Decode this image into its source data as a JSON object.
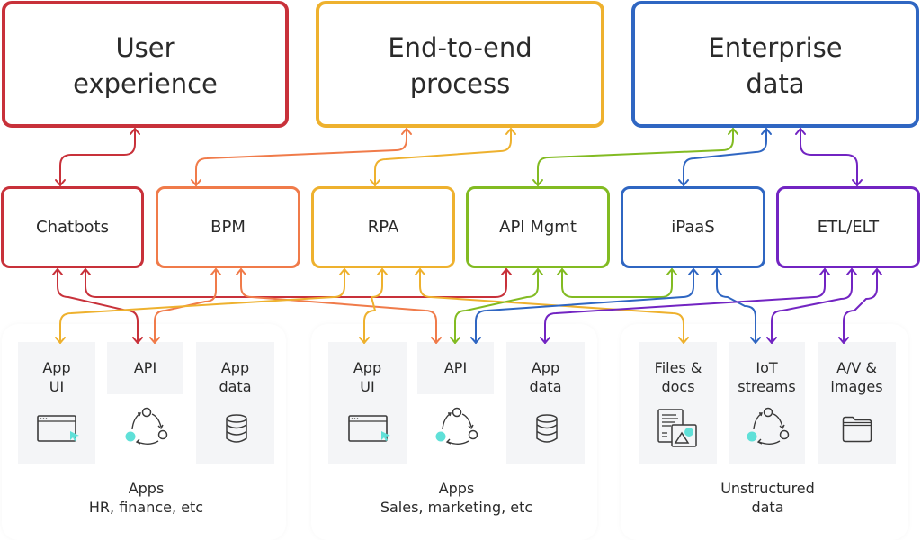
{
  "colors": {
    "red": "#c8313a",
    "orange": "#f07b4a",
    "yellow": "#eeb12e",
    "green": "#82bb22",
    "blue": "#2f66c2",
    "purple": "#7224c2",
    "tile_bg": "#f4f5f7",
    "teal_accent": "#5fe0d8"
  },
  "goals": [
    {
      "id": "ux",
      "label": "User\nexperience",
      "color": "red"
    },
    {
      "id": "e2e",
      "label": "End-to-end\nprocess",
      "color": "yellow"
    },
    {
      "id": "enterprise",
      "label": "Enterprise\ndata",
      "color": "blue"
    }
  ],
  "tools": [
    {
      "id": "chatbots",
      "label": "Chatbots",
      "color": "red"
    },
    {
      "id": "bpm",
      "label": "BPM",
      "color": "orange"
    },
    {
      "id": "rpa",
      "label": "RPA",
      "color": "yellow"
    },
    {
      "id": "apimgmt",
      "label": "API Mgmt",
      "color": "green"
    },
    {
      "id": "ipaas",
      "label": "iPaaS",
      "color": "blue"
    },
    {
      "id": "etl",
      "label": "ETL/ELT",
      "color": "purple"
    }
  ],
  "groups": [
    {
      "caption": "Apps\nHR, finance, etc",
      "tiles": [
        {
          "label": "App\nUI",
          "icon": "browser-window-icon"
        },
        {
          "label": "API",
          "icon": "cycle-icon"
        },
        {
          "label": "App\ndata",
          "icon": "database-icon"
        }
      ]
    },
    {
      "caption": "Apps\nSales, marketing, etc",
      "tiles": [
        {
          "label": "App\nUI",
          "icon": "browser-window-icon"
        },
        {
          "label": "API",
          "icon": "cycle-icon"
        },
        {
          "label": "App\ndata",
          "icon": "database-icon"
        }
      ]
    },
    {
      "caption": "Unstructured\ndata",
      "tiles": [
        {
          "label": "Files &\ndocs",
          "icon": "document-image-icon"
        },
        {
          "label": "IoT\nstreams",
          "icon": "cycle-icon"
        },
        {
          "label": "A/V &\nimages",
          "icon": "folder-icon"
        }
      ]
    }
  ],
  "connections": [
    {
      "from": "chatbots",
      "to": "ux",
      "color": "red"
    },
    {
      "from": "bpm",
      "to": "e2e",
      "color": "orange"
    },
    {
      "from": "rpa",
      "to": "e2e",
      "color": "yellow"
    },
    {
      "from": "apimgmt",
      "to": "enterprise",
      "color": "green"
    },
    {
      "from": "ipaas",
      "to": "enterprise",
      "color": "blue"
    },
    {
      "from": "etl",
      "to": "enterprise",
      "color": "purple"
    },
    {
      "from": "chatbots",
      "to": "apps-hr.api",
      "color": "red"
    },
    {
      "from": "chatbots",
      "to": "apimgmt",
      "color": "red"
    },
    {
      "from": "bpm",
      "to": "apps-hr.api",
      "color": "orange"
    },
    {
      "from": "bpm",
      "to": "apps-sales.api",
      "color": "orange"
    },
    {
      "from": "rpa",
      "to": "apps-hr.app-ui",
      "color": "yellow"
    },
    {
      "from": "rpa",
      "to": "apps-sales.app-ui",
      "color": "yellow"
    },
    {
      "from": "rpa",
      "to": "unstructured.files",
      "color": "yellow"
    },
    {
      "from": "apimgmt",
      "to": "apps-sales.api",
      "color": "green"
    },
    {
      "from": "apimgmt",
      "to": "ipaas",
      "color": "green"
    },
    {
      "from": "ipaas",
      "to": "apps-sales.api",
      "color": "blue"
    },
    {
      "from": "ipaas",
      "to": "unstructured.iot",
      "color": "blue"
    },
    {
      "from": "etl",
      "to": "apps-sales.app-data",
      "color": "purple"
    },
    {
      "from": "etl",
      "to": "unstructured.iot",
      "color": "purple"
    },
    {
      "from": "etl",
      "to": "unstructured.av",
      "color": "purple"
    }
  ]
}
